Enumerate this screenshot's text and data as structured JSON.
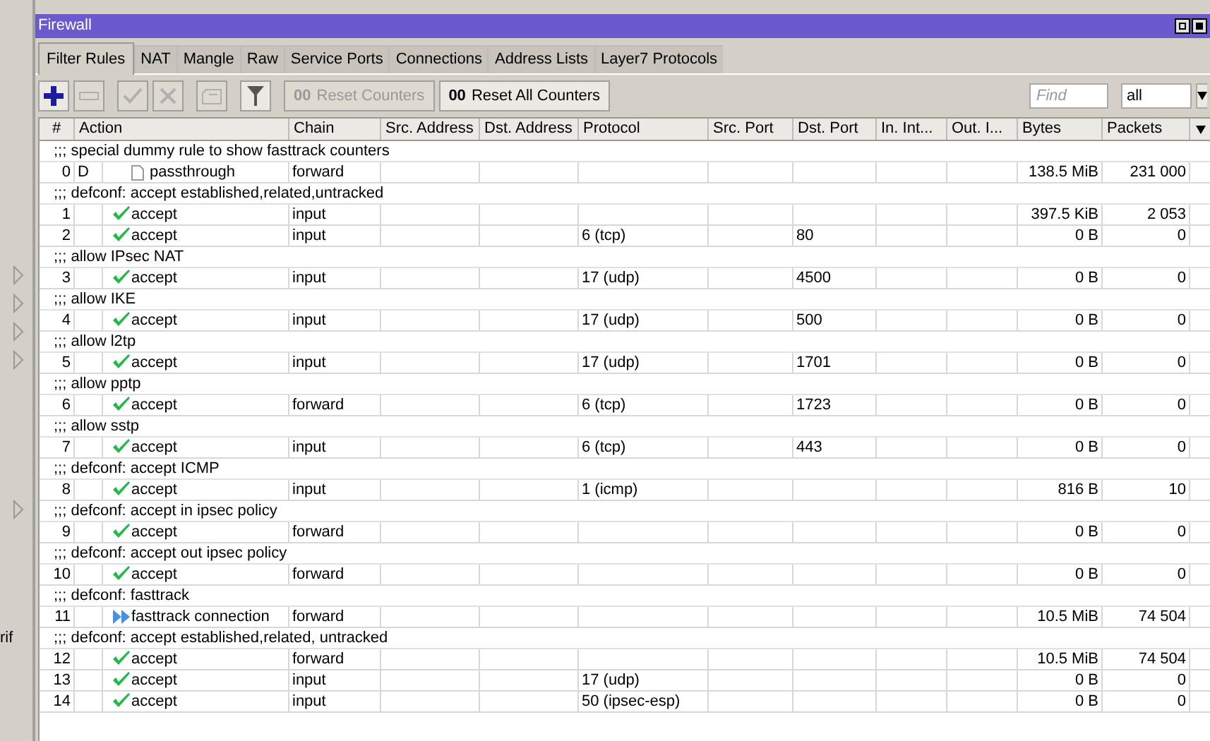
{
  "left_panel": {
    "items": [
      {
        "kind": "arrow"
      },
      {
        "kind": "arrow"
      },
      {
        "kind": "arrow"
      },
      {
        "kind": "arrow"
      },
      {
        "kind": "arrow"
      },
      {
        "kind": "text",
        "label": "rif"
      }
    ]
  },
  "window": {
    "title": "Firewall"
  },
  "tabs": [
    {
      "label": "Filter Rules",
      "selected": true
    },
    {
      "label": "NAT",
      "selected": false
    },
    {
      "label": "Mangle",
      "selected": false
    },
    {
      "label": "Raw",
      "selected": false
    },
    {
      "label": "Service Ports",
      "selected": false
    },
    {
      "label": "Connections",
      "selected": false
    },
    {
      "label": "Address Lists",
      "selected": false
    },
    {
      "label": "Layer7 Protocols",
      "selected": false
    }
  ],
  "toolbar": {
    "buttons": [
      {
        "kind": "add",
        "disabled": false
      },
      {
        "kind": "remove",
        "disabled": true
      },
      {
        "kind": "enable",
        "disabled": true
      },
      {
        "kind": "disable",
        "disabled": true
      },
      {
        "kind": "comment",
        "disabled": true
      },
      {
        "kind": "filter",
        "disabled": false
      }
    ],
    "counter_buttons": [
      {
        "icon": "00",
        "label": "Reset Counters",
        "disabled": true
      },
      {
        "icon": "00",
        "label": "Reset All Counters",
        "disabled": false
      }
    ],
    "find": {
      "placeholder": "Find"
    },
    "scope": {
      "value": "all"
    }
  },
  "table": {
    "columns": [
      "#",
      "Action",
      "Chain",
      "Src. Address",
      "Dst. Address",
      "Protocol",
      "Src. Port",
      "Dst. Port",
      "In. Int...",
      "Out. I...",
      "Bytes",
      "Packets"
    ],
    "rows": [
      {
        "kind": "comment",
        "text": ";;; special dummy rule to show fasttrack counters"
      },
      {
        "kind": "rule",
        "number": "0",
        "flag": "D",
        "action": {
          "kind": "passthrough",
          "label": "passthrough"
        },
        "chain": "forward",
        "bytes": "138.5 MiB",
        "packets": "231 000"
      },
      {
        "kind": "comment",
        "text": ";;; defconf: accept established,related,untracked"
      },
      {
        "kind": "rule",
        "number": "1",
        "action": {
          "kind": "accept",
          "label": "accept"
        },
        "chain": "input",
        "bytes": "397.5 KiB",
        "packets": "2 053"
      },
      {
        "kind": "rule",
        "number": "2",
        "action": {
          "kind": "accept",
          "label": "accept"
        },
        "chain": "input",
        "protocol": "6 (tcp)",
        "dst_port": "80",
        "bytes": "0 B",
        "packets": "0"
      },
      {
        "kind": "comment",
        "text": ";;; allow IPsec NAT"
      },
      {
        "kind": "rule",
        "number": "3",
        "action": {
          "kind": "accept",
          "label": "accept"
        },
        "chain": "input",
        "protocol": "17 (udp)",
        "dst_port": "4500",
        "bytes": "0 B",
        "packets": "0"
      },
      {
        "kind": "comment",
        "text": ";;; allow IKE"
      },
      {
        "kind": "rule",
        "number": "4",
        "action": {
          "kind": "accept",
          "label": "accept"
        },
        "chain": "input",
        "protocol": "17 (udp)",
        "dst_port": "500",
        "bytes": "0 B",
        "packets": "0"
      },
      {
        "kind": "comment",
        "text": ";;; allow l2tp"
      },
      {
        "kind": "rule",
        "number": "5",
        "action": {
          "kind": "accept",
          "label": "accept"
        },
        "chain": "input",
        "protocol": "17 (udp)",
        "dst_port": "1701",
        "bytes": "0 B",
        "packets": "0"
      },
      {
        "kind": "comment",
        "text": ";;; allow pptp"
      },
      {
        "kind": "rule",
        "number": "6",
        "action": {
          "kind": "accept",
          "label": "accept"
        },
        "chain": "forward",
        "protocol": "6 (tcp)",
        "dst_port": "1723",
        "bytes": "0 B",
        "packets": "0"
      },
      {
        "kind": "comment",
        "text": ";;; allow sstp"
      },
      {
        "kind": "rule",
        "number": "7",
        "action": {
          "kind": "accept",
          "label": "accept"
        },
        "chain": "input",
        "protocol": "6 (tcp)",
        "dst_port": "443",
        "bytes": "0 B",
        "packets": "0"
      },
      {
        "kind": "comment",
        "text": ";;; defconf: accept ICMP"
      },
      {
        "kind": "rule",
        "number": "8",
        "action": {
          "kind": "accept",
          "label": "accept"
        },
        "chain": "input",
        "protocol": "1 (icmp)",
        "bytes": "816 B",
        "packets": "10"
      },
      {
        "kind": "comment",
        "text": ";;; defconf: accept in ipsec policy"
      },
      {
        "kind": "rule",
        "number": "9",
        "action": {
          "kind": "accept",
          "label": "accept"
        },
        "chain": "forward",
        "bytes": "0 B",
        "packets": "0"
      },
      {
        "kind": "comment",
        "text": ";;; defconf: accept out ipsec policy"
      },
      {
        "kind": "rule",
        "number": "10",
        "action": {
          "kind": "accept",
          "label": "accept"
        },
        "chain": "forward",
        "bytes": "0 B",
        "packets": "0"
      },
      {
        "kind": "comment",
        "text": ";;; defconf: fasttrack"
      },
      {
        "kind": "rule",
        "number": "11",
        "action": {
          "kind": "fasttrack",
          "label": "fasttrack connection"
        },
        "chain": "forward",
        "bytes": "10.5 MiB",
        "packets": "74 504"
      },
      {
        "kind": "comment",
        "text": ";;; defconf: accept established,related, untracked"
      },
      {
        "kind": "rule",
        "number": "12",
        "action": {
          "kind": "accept",
          "label": "accept"
        },
        "chain": "forward",
        "bytes": "10.5 MiB",
        "packets": "74 504"
      },
      {
        "kind": "rule",
        "number": "13",
        "action": {
          "kind": "accept",
          "label": "accept"
        },
        "chain": "input",
        "protocol": "17 (udp)",
        "bytes": "0 B",
        "packets": "0"
      },
      {
        "kind": "rule",
        "number": "14",
        "action": {
          "kind": "accept",
          "label": "accept"
        },
        "chain": "input",
        "protocol": "50 (ipsec-esp)",
        "bytes": "0 B",
        "packets": "0"
      }
    ]
  }
}
